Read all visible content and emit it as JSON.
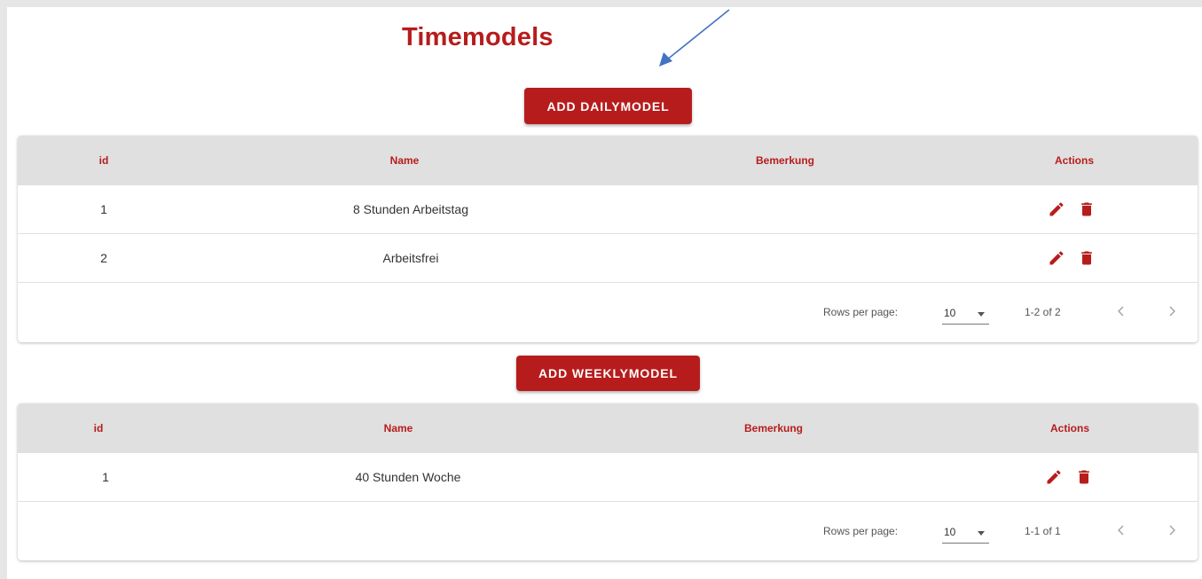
{
  "page": {
    "title": "Timemodels",
    "accent_color": "#b71c1c",
    "header_bg": "#e0e0e0"
  },
  "daily": {
    "add_label": "ADD DAILYMODEL",
    "headers": [
      "id",
      "Name",
      "Bemerkung",
      "Actions"
    ],
    "rows": [
      {
        "id": "1",
        "name": "8 Stunden Arbeitstag",
        "bemerkung": ""
      },
      {
        "id": "2",
        "name": "Arbeitsfrei",
        "bemerkung": ""
      }
    ],
    "rows_per_page_label": "Rows per page:",
    "rows_per_page_value": "10",
    "range": "1-2 of 2"
  },
  "weekly": {
    "add_label": "ADD WEEKLYMODEL",
    "headers": [
      "id",
      "Name",
      "Bemerkung",
      "Actions"
    ],
    "rows": [
      {
        "id": "1",
        "name": "40 Stunden Woche",
        "bemerkung": ""
      }
    ],
    "rows_per_page_label": "Rows per page:",
    "rows_per_page_value": "10",
    "range": "1-1 of 1"
  },
  "icons": {
    "edit": "pencil-icon",
    "delete": "trash-icon",
    "prev": "chevron-left-icon",
    "next": "chevron-right-icon"
  }
}
